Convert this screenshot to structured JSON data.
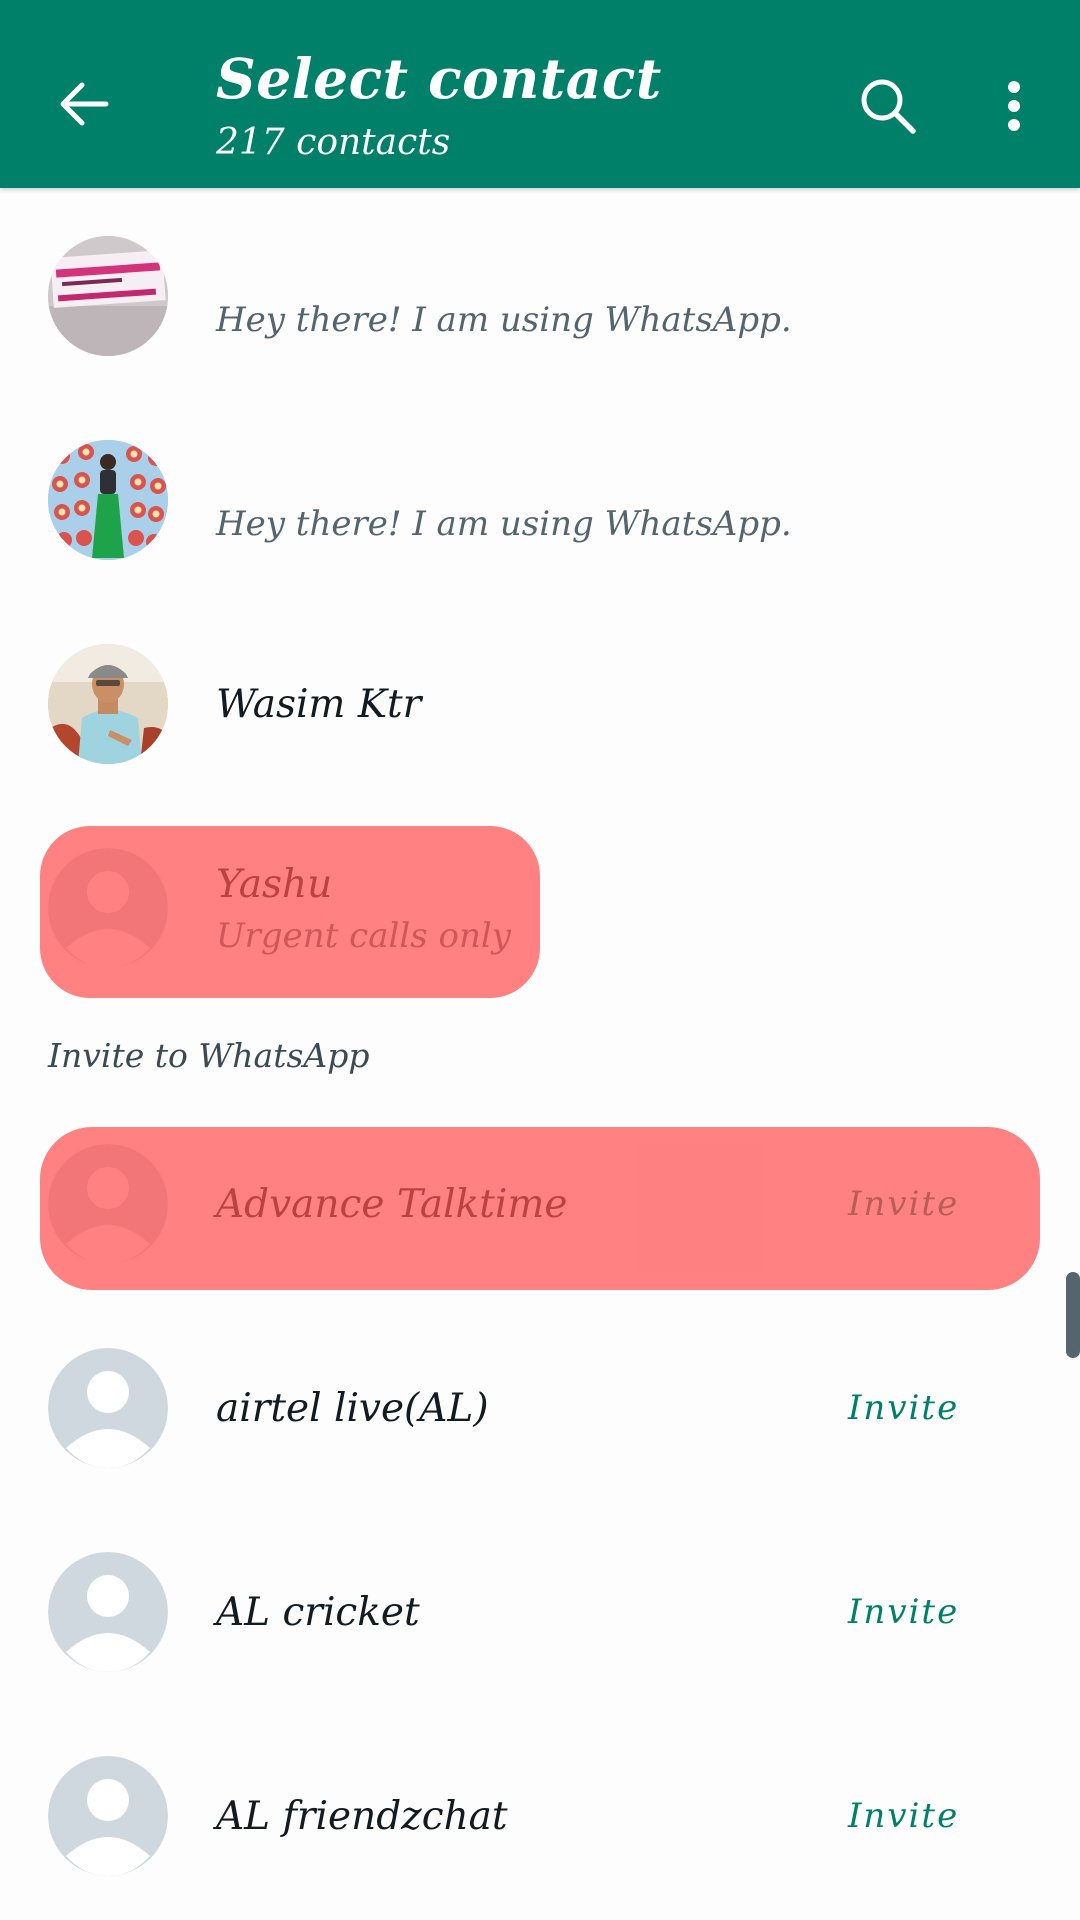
{
  "header": {
    "title": "Select contact",
    "subtitle": "217 contacts",
    "back_icon": "arrow-left-icon",
    "search_icon": "search-icon",
    "menu_icon": "more-vertical-icon",
    "background_color": "#008069"
  },
  "contacts": [
    {
      "name": "",
      "status": "Hey there! I am using WhatsApp.",
      "avatar": "ritika-shop-photo"
    },
    {
      "name": "",
      "status": "Hey there! I am using WhatsApp.",
      "avatar": "badge-collage-photo"
    },
    {
      "name": "Wasim Ktr",
      "status": "",
      "avatar": "man-in-cap-photo"
    },
    {
      "name": "Yashu",
      "status": "Urgent calls only",
      "avatar": "default-person-icon",
      "highlighted": true
    }
  ],
  "invite_section": {
    "label": "Invite to WhatsApp",
    "items": [
      {
        "name": "Advance Talktime",
        "action": "Invite",
        "highlighted": true
      },
      {
        "name": "airtel live(AL)",
        "action": "Invite"
      },
      {
        "name": "AL cricket",
        "action": "Invite"
      },
      {
        "name": "AL friendzchat",
        "action": "Invite"
      }
    ]
  },
  "colors": {
    "accent": "#008069",
    "highlight": "#ff5050",
    "default_avatar": "#cfd8df"
  }
}
